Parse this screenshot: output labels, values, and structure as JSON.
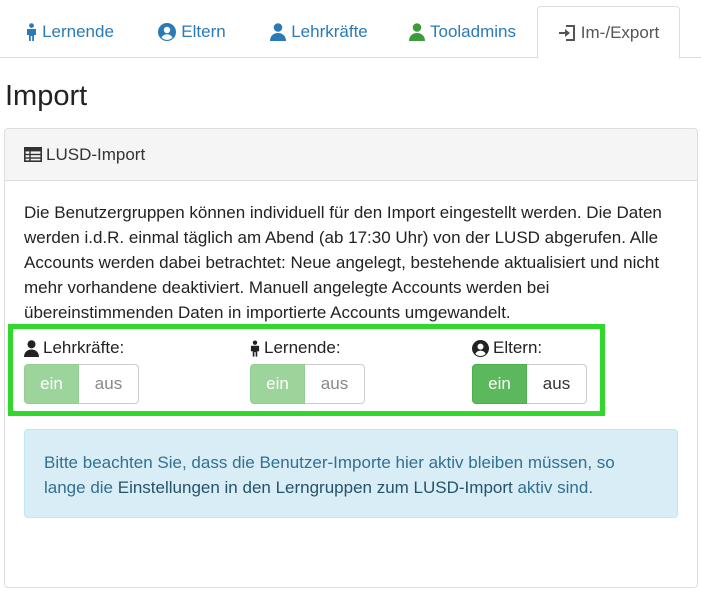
{
  "tabs": [
    {
      "label": "Lernende",
      "icon": "child-icon"
    },
    {
      "label": "Eltern",
      "icon": "user-circle-icon"
    },
    {
      "label": "Lehrkräfte",
      "icon": "user-icon"
    },
    {
      "label": "Tooladmins",
      "icon": "user-icon"
    },
    {
      "label": "Im-/Export",
      "icon": "sign-in-icon",
      "active": true
    }
  ],
  "page": {
    "title": "Import"
  },
  "panel": {
    "heading": "LUSD-Import",
    "description": "Die Benutzergruppen können individuell für den Import eingestellt werden. Die Daten werden i.d.R. einmal täglich am Abend (ab 17:30 Uhr) von der LUSD abgerufen. Alle Accounts werden dabei betrachtet: Neue angelegt, bestehende aktualisiert und nicht mehr vorhandene deaktiviert. Manuell angelegte Accounts werden bei übereinstimmenden Daten in importierte Accounts umgewandelt."
  },
  "toggles": [
    {
      "label": "Lehrkräfte:",
      "on_label": "ein",
      "off_label": "aus",
      "state": "ein",
      "enabled": false
    },
    {
      "label": "Lernende:",
      "on_label": "ein",
      "off_label": "aus",
      "state": "ein",
      "enabled": false
    },
    {
      "label": "Eltern:",
      "on_label": "ein",
      "off_label": "aus",
      "state": "ein",
      "enabled": true
    }
  ],
  "alert": {
    "text_before": "Bitte beachten Sie, dass die Benutzer-Importe hier aktiv bleiben müssen, so lange die ",
    "link": "Einstellungen in den Lerngruppen zum LUSD-Import",
    "text_after": " aktiv sind."
  },
  "colors": {
    "tab_link": "#2a7ab7",
    "admin_icon": "#3c9c3c",
    "success": "#5cb85c",
    "highlight": "#2fd82a",
    "alert_bg": "#d9edf7",
    "alert_text": "#31708f"
  }
}
